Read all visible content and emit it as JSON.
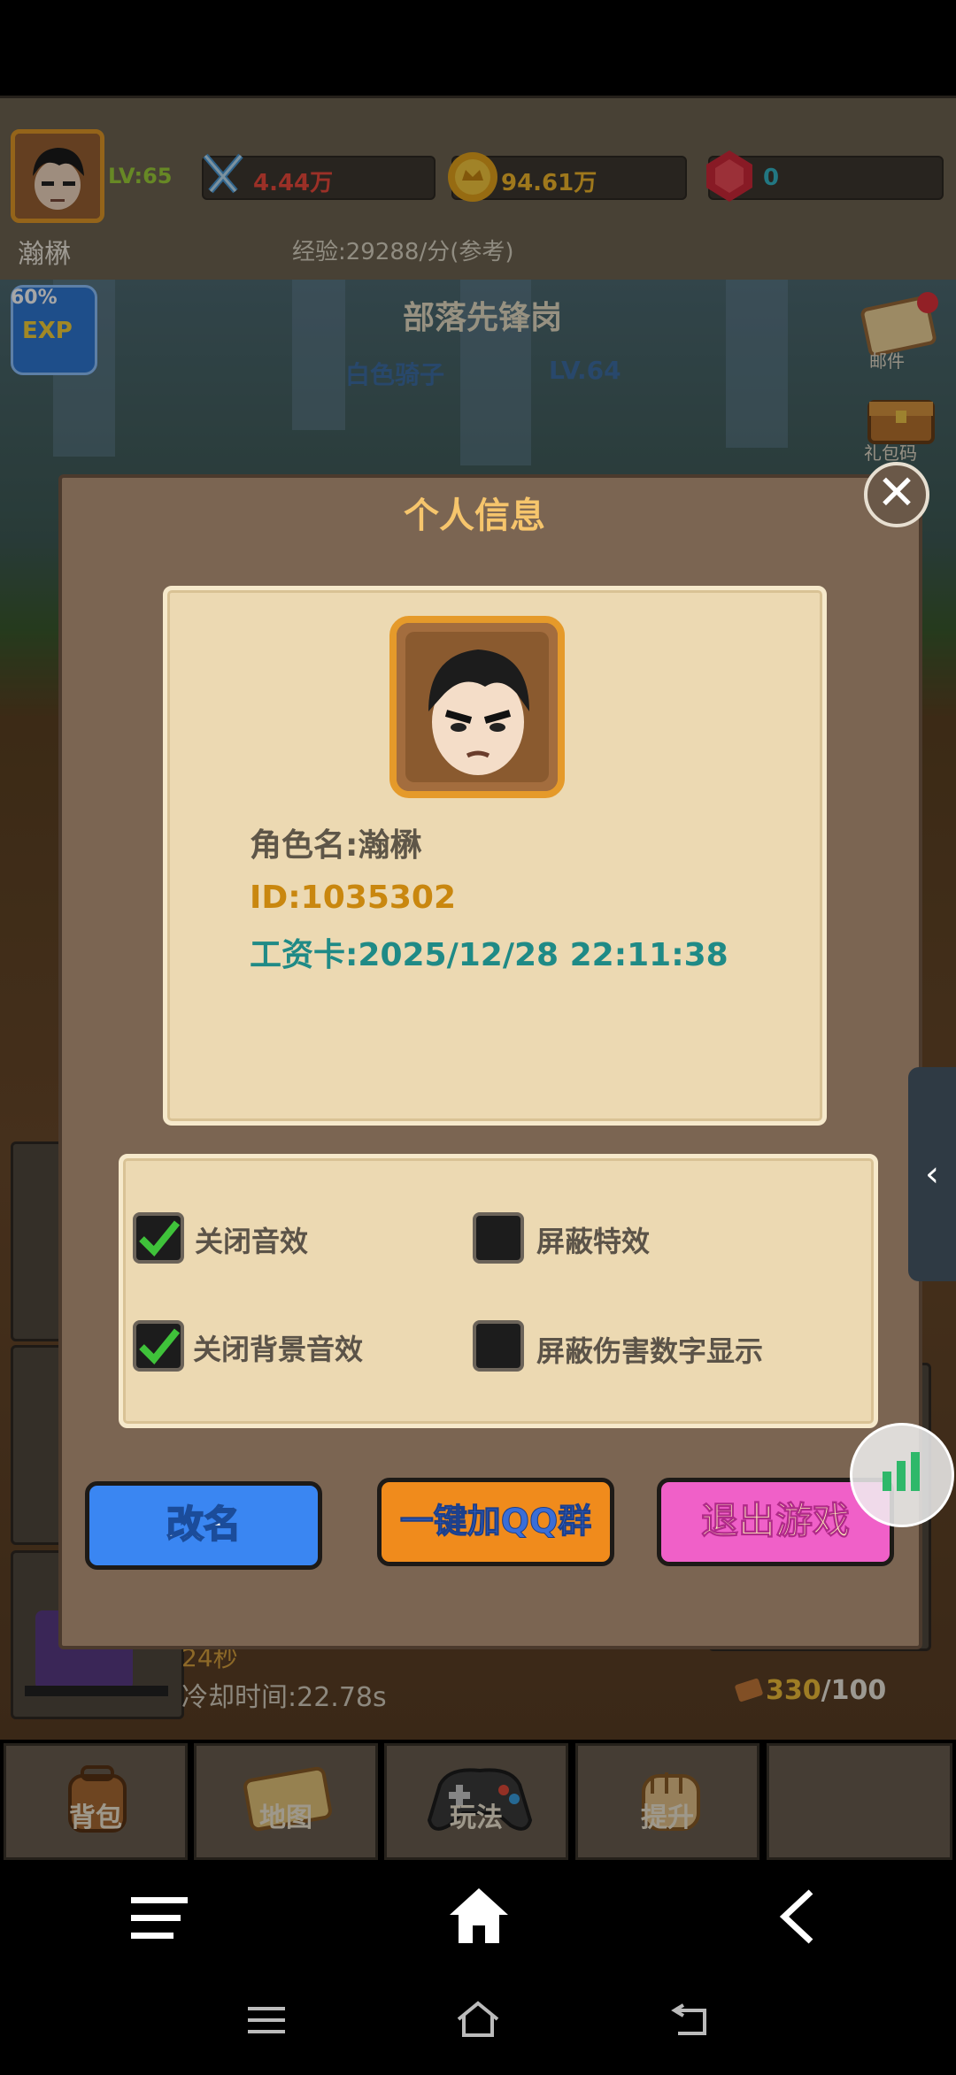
{
  "hud": {
    "level": "LV:65",
    "power": "4.44万",
    "gold": "94.61万",
    "gems": "0",
    "player_name": "瀚楙",
    "exp_rate": "经验:29288/分(参考)"
  },
  "scene": {
    "exp_percent": "60%",
    "exp_badge": "EXP",
    "area_name": "部落先锋岗",
    "boss_name": "白色骑子",
    "boss_level": "LV.64",
    "mail_label": "邮件",
    "gift_label": "礼包码"
  },
  "dialog": {
    "title": "个人信息",
    "role_name": "角色名:瀚楙",
    "player_id": "ID:1035302",
    "salary_card": "工资卡:2025/12/28 22:11:38",
    "options": [
      {
        "label": "关闭音效",
        "checked": true
      },
      {
        "label": "屏蔽特效",
        "checked": false
      },
      {
        "label": "关闭背景音效",
        "checked": true
      },
      {
        "label": "屏蔽伤害数字显示",
        "checked": false
      }
    ],
    "rename_button": "改名",
    "qq_button": "一键加QQ群",
    "exit_button": "退出游戏"
  },
  "bottom": {
    "seconds": "24秒",
    "cooldown": "冷却时间:22.78s",
    "resource_current": "330",
    "resource_max": "/100",
    "nav": [
      "背包",
      "地图",
      "玩法",
      "提升"
    ]
  },
  "colors": {
    "role_name": "#5e5648",
    "id": "#c9870f",
    "salary": "#1f8a86",
    "rename_bg": "#3a86f2",
    "qq_bg": "#f08b1c",
    "exit_bg": "#f060c8"
  }
}
